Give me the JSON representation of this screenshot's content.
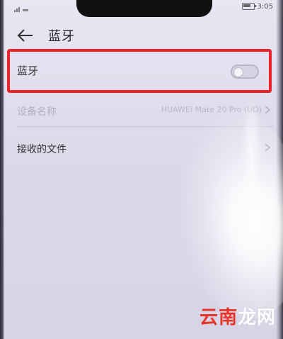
{
  "status_bar": {
    "time": "3:05"
  },
  "header": {
    "back_icon": "arrow-left-icon",
    "title": "蓝牙"
  },
  "bluetooth_row": {
    "label": "蓝牙",
    "toggle_on": false
  },
  "device_name_row": {
    "label": "设备名称",
    "value": "HUAWEI Mate 20 Pro (UD)"
  },
  "received_files_row": {
    "label": "接收的文件"
  },
  "watermark": {
    "chars": [
      "云",
      "南",
      "龙",
      "网"
    ]
  },
  "colors": {
    "highlight": "#e8232a",
    "background": "#ddd9ea"
  }
}
